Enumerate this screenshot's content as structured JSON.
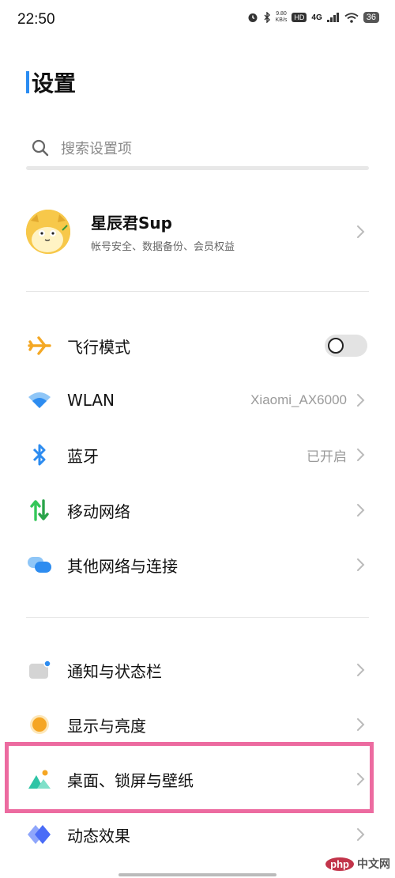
{
  "status_bar": {
    "time": "22:50",
    "net_speed_value": "9.80",
    "net_speed_unit": "KB/s",
    "hd_badge": "HD",
    "network_type": "4G",
    "battery": "36"
  },
  "page": {
    "title": "设置"
  },
  "search": {
    "placeholder": "搜索设置项"
  },
  "profile": {
    "name": "星辰君Sup",
    "subtitle": "帐号安全、数据备份、会员权益"
  },
  "network_section": {
    "items": [
      {
        "label": "飞行模式",
        "value": "",
        "control": "toggle",
        "toggle_on": false,
        "icon": "airplane-icon",
        "icon_color": "#f4a825"
      },
      {
        "label": "WLAN",
        "value": "Xiaomi_AX6000",
        "control": "chevron",
        "icon": "wifi-icon",
        "icon_color": "#2d8cf0"
      },
      {
        "label": "蓝牙",
        "value": "已开启",
        "control": "chevron",
        "icon": "bluetooth-icon",
        "icon_color": "#2d8cf0"
      },
      {
        "label": "移动网络",
        "value": "",
        "control": "chevron",
        "icon": "mobile-data-icon",
        "icon_color": "#34c759"
      },
      {
        "label": "其他网络与连接",
        "value": "",
        "control": "chevron",
        "icon": "connection-icon",
        "icon_color": "#2d8cf0"
      }
    ]
  },
  "display_section": {
    "items": [
      {
        "label": "通知与状态栏",
        "icon": "notification-icon",
        "icon_color": "#c8c8c8"
      },
      {
        "label": "显示与亮度",
        "icon": "brightness-icon",
        "icon_color": "#f5a623"
      },
      {
        "label": "桌面、锁屏与壁纸",
        "icon": "wallpaper-icon",
        "icon_color": "#2ec4a6",
        "highlighted": true
      },
      {
        "label": "动态效果",
        "icon": "animation-icon",
        "icon_color": "#4a6cf7"
      }
    ]
  },
  "colors": {
    "title_accent": "#2a8cf2",
    "highlight_border": "#ec6ba0"
  },
  "watermark": {
    "badge": "php",
    "text": "中文网"
  }
}
